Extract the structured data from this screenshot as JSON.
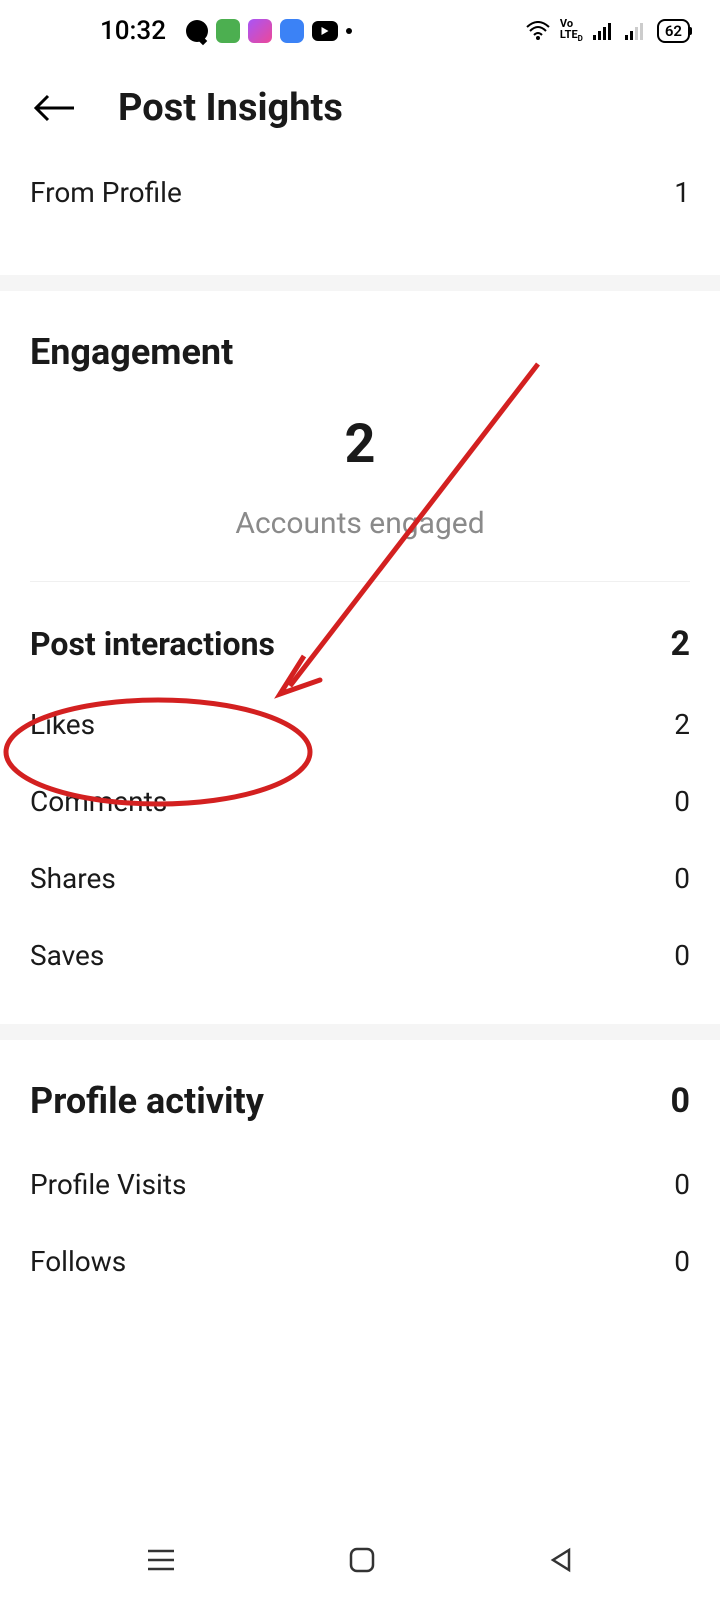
{
  "status_bar": {
    "time": "10:32",
    "battery": "62"
  },
  "header": {
    "title": "Post Insights"
  },
  "from_profile": {
    "label": "From Profile",
    "value": "1"
  },
  "engagement": {
    "title": "Engagement",
    "accounts_engaged_value": "2",
    "accounts_engaged_label": "Accounts engaged",
    "post_interactions": {
      "label": "Post interactions",
      "value": "2"
    },
    "metrics": [
      {
        "label": "Likes",
        "value": "2"
      },
      {
        "label": "Comments",
        "value": "0"
      },
      {
        "label": "Shares",
        "value": "0"
      },
      {
        "label": "Saves",
        "value": "0"
      }
    ]
  },
  "profile_activity": {
    "title": "Profile activity",
    "value": "0",
    "metrics": [
      {
        "label": "Profile Visits",
        "value": "0"
      },
      {
        "label": "Follows",
        "value": "0"
      }
    ]
  },
  "annotation": {
    "color": "#d32020"
  }
}
